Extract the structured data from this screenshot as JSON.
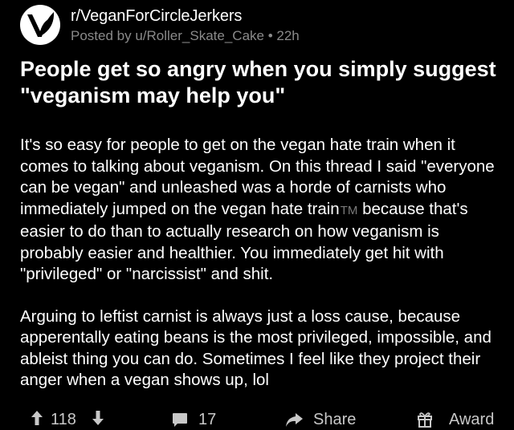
{
  "header": {
    "subreddit": "r/VeganForCircleJerkers",
    "byline": "Posted by u/Roller_Skate_Cake • 22h",
    "avatar_icon": "vegan-leaf-icon"
  },
  "post": {
    "title": "People get so angry when you simply suggest \"veganism may help you\"",
    "paragraph1": "It's so easy for people to get on the vegan hate train when it comes to talking about veganism. On this thread I said \"everyone can be vegan\" and unleashed was a horde of carnists who immediately jumped on the vegan hate train",
    "trademark": "TM",
    "paragraph1_cont": " because that's easier to do than to actually research on how veganism is probably easier and healthier. You immediately get hit with \"privileged\" or \"narcissist\" and shit.",
    "paragraph2": "Arguing to leftist carnist is always just a loss cause, because apperentally eating beans is the most privileged, impossible, and ableist thing you can do. Sometimes I feel like they project their anger when a vegan shows up, lol"
  },
  "actions": {
    "vote_count": "118",
    "comment_count": "17",
    "share_label": "Share",
    "award_label": "Award"
  },
  "colors": {
    "background": "#000000",
    "text": "#ffffff",
    "muted": "#8a8a8a",
    "action": "#c8c8c8"
  }
}
